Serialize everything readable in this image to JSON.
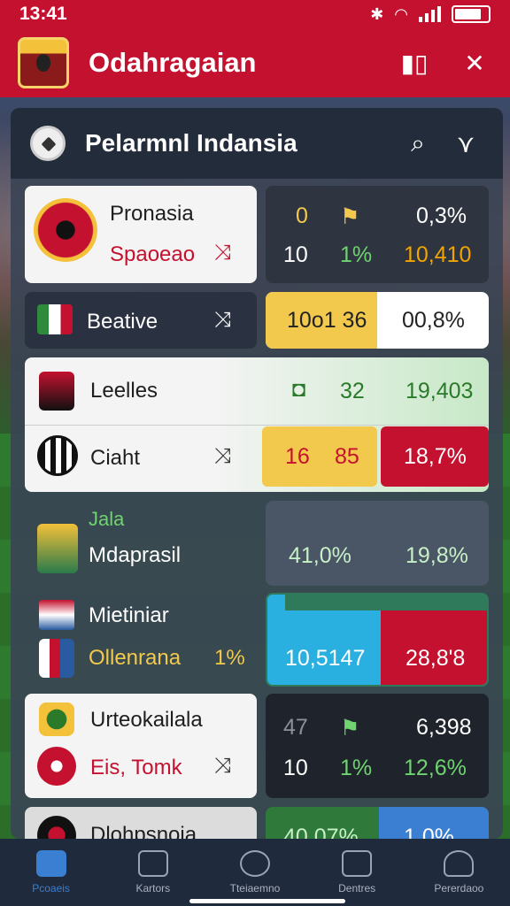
{
  "status": {
    "time": "13:41"
  },
  "app": {
    "title": "Odahragaian"
  },
  "panel": {
    "title": "Pelarmnl Indansia"
  },
  "rows": [
    {
      "team_a": "Pronasia",
      "team_b": "Spaoeao",
      "vals": [
        "0",
        "10",
        "1%",
        "0,3%",
        "10,410"
      ]
    },
    {
      "team_a": "Beative",
      "left_val": "10o1 36",
      "right_val": "00,8%"
    },
    {
      "team_a": "Leelles",
      "team_b": "Ciaht",
      "vals": [
        "32",
        "19,403",
        "16",
        "85",
        "18,7%"
      ]
    },
    {
      "label_top": "Jala",
      "team_a": "Mdaprasil",
      "vals": [
        "41,0%",
        "19,8%"
      ]
    },
    {
      "team_a": "Mietiniar",
      "team_b": "Ollenrana",
      "pct": "1%",
      "vals": [
        "10,5147",
        "28,8'8"
      ]
    },
    {
      "team_a": "Urteokailala",
      "team_b": "Eis, Tomk",
      "vals": [
        "47",
        "6,398",
        "10",
        "1%",
        "12,6%"
      ]
    },
    {
      "team_a": "Dlohpsnoia",
      "vals": [
        "40,07%",
        "1,0%"
      ]
    }
  ],
  "nav": [
    {
      "label": "Pcoaeis",
      "icon": "home-icon",
      "active": true
    },
    {
      "label": "Kartors",
      "icon": "grid-icon",
      "active": false
    },
    {
      "label": "Tteiaemno",
      "icon": "clock-icon",
      "active": false
    },
    {
      "label": "Dentres",
      "icon": "house-icon",
      "active": false
    },
    {
      "label": "Pererdaoo",
      "icon": "user-icon",
      "active": false
    }
  ],
  "colors": {
    "brand": "#c4112f",
    "accent_yellow": "#f2c94c",
    "accent_green": "#6fd36f",
    "accent_orange": "#f0a500",
    "accent_blue": "#2ab0e0"
  }
}
